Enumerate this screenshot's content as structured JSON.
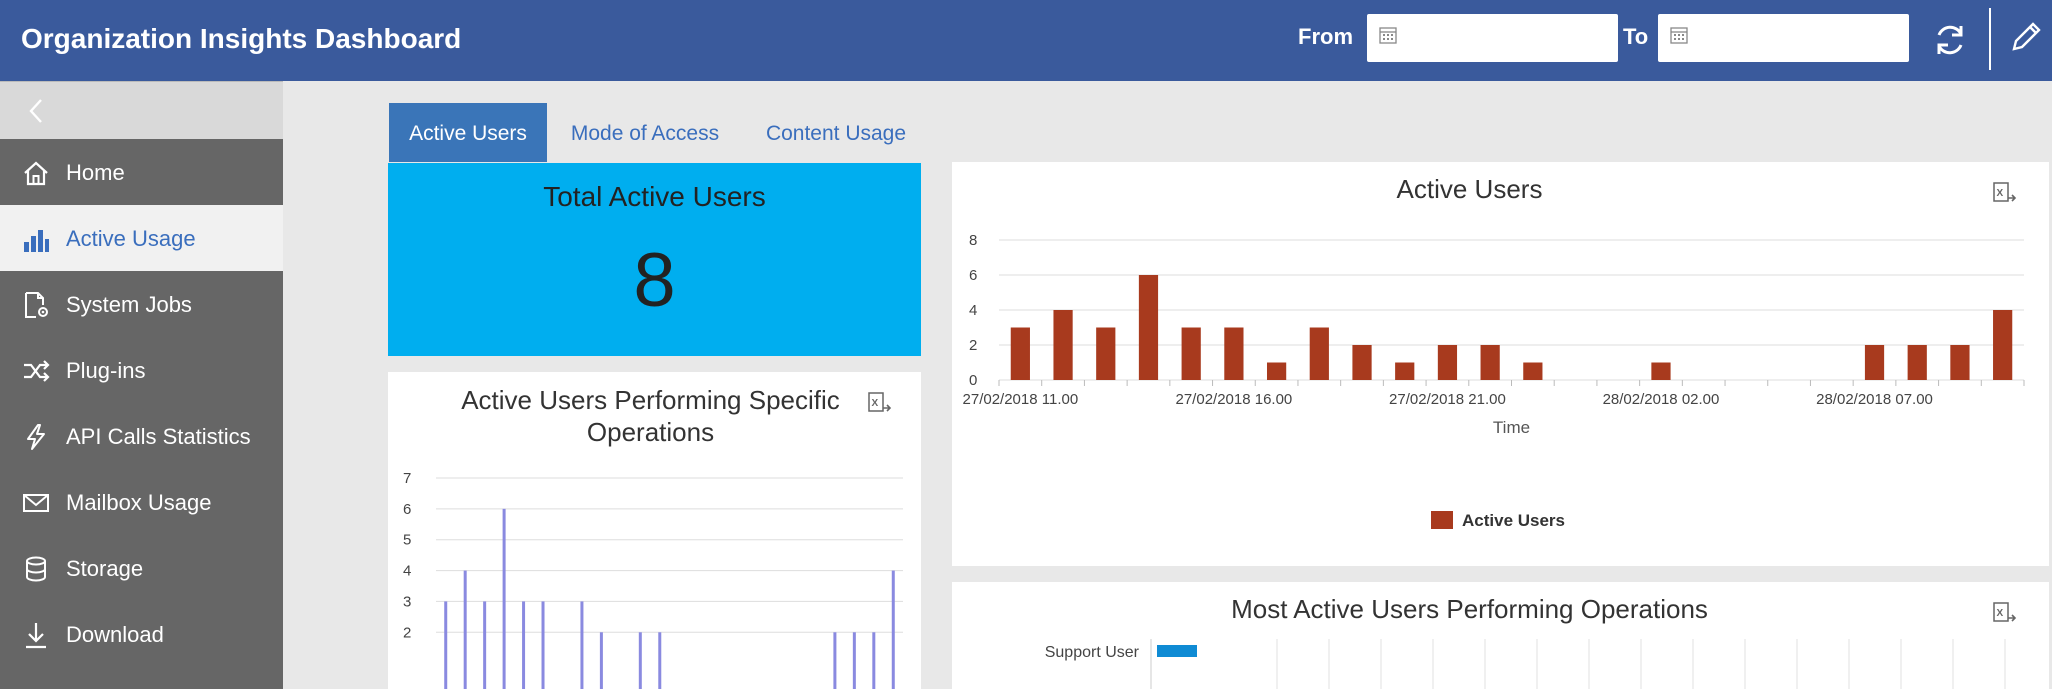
{
  "header": {
    "title": "Organization Insights Dashboard",
    "from_label": "From",
    "to_label": "To",
    "from_value": "",
    "to_value": "",
    "color": "#3a5a9c"
  },
  "sidebar": {
    "items": [
      {
        "label": "Home",
        "icon": "home-icon"
      },
      {
        "label": "Active Usage",
        "icon": "bar-chart-icon"
      },
      {
        "label": "System Jobs",
        "icon": "system-jobs-icon"
      },
      {
        "label": "Plug-ins",
        "icon": "shuffle-icon"
      },
      {
        "label": "API Calls Statistics",
        "icon": "lightning-icon"
      },
      {
        "label": "Mailbox Usage",
        "icon": "envelope-icon"
      },
      {
        "label": "Storage",
        "icon": "database-icon"
      },
      {
        "label": "Download",
        "icon": "download-icon"
      }
    ]
  },
  "tabs": [
    {
      "label": "Active Users"
    },
    {
      "label": "Mode of Access"
    },
    {
      "label": "Content Usage"
    }
  ],
  "kpi": {
    "title": "Total Active Users",
    "value": "8",
    "color": "#00aeef"
  },
  "ops_card": {
    "title_line1": "Active Users Performing Specific",
    "title_line2": "Operations"
  },
  "active_card": {
    "title": "Active Users"
  },
  "most_card": {
    "title": "Most Active Users Performing Operations",
    "first_user": "Support User"
  },
  "chart_data": [
    {
      "type": "bar",
      "title": "Active Users",
      "xlabel": "Time",
      "ylabel": "",
      "ylim": [
        0,
        8
      ],
      "yticks": [
        "0",
        "2",
        "4",
        "6",
        "8"
      ],
      "xtick_labels": [
        "27/02/2018 11.00",
        "27/02/2018 16.00",
        "27/02/2018 21.00",
        "28/02/2018 02.00",
        "28/02/2018 07.00"
      ],
      "legend": "bottom",
      "series": [
        {
          "name": "Active Users",
          "color": "#a83a1e",
          "values": [
            3,
            4,
            3,
            6,
            3,
            3,
            1,
            3,
            2,
            1,
            2,
            2,
            1,
            0,
            0,
            1,
            0,
            0,
            0,
            0,
            2,
            2,
            2,
            4
          ]
        }
      ]
    },
    {
      "type": "bar",
      "title": "Active Users Performing Specific Operations",
      "ylim": [
        0,
        7
      ],
      "yticks": [
        "2",
        "3",
        "4",
        "5",
        "6",
        "7"
      ],
      "series": [
        {
          "color": "#8a8ae0",
          "values": [
            3,
            4,
            3,
            6,
            3,
            3,
            0,
            3,
            2,
            0,
            2,
            2,
            0,
            0,
            0,
            0,
            0,
            0,
            0,
            0,
            2,
            2,
            2,
            4
          ]
        }
      ]
    },
    {
      "type": "bar",
      "title": "Most Active Users Performing Operations",
      "orientation": "horizontal",
      "categories": [
        "Support User"
      ],
      "series": [
        {
          "color": "#0f8bd4",
          "values": [
            1
          ]
        }
      ]
    }
  ]
}
